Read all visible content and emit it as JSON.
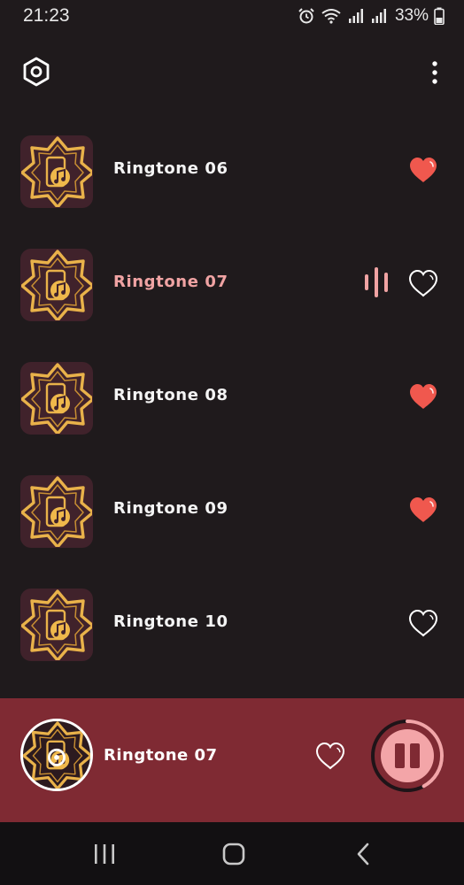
{
  "status_bar": {
    "time": "21:23",
    "battery": "33%"
  },
  "top_bar": {
    "settings_icon": "hexagon-settings-icon",
    "menu_icon": "more-vertical-icon"
  },
  "ringtones": [
    {
      "title": "Ringtone 06",
      "favorite": true,
      "playing": false
    },
    {
      "title": "Ringtone 07",
      "favorite": false,
      "playing": true
    },
    {
      "title": "Ringtone 08",
      "favorite": true,
      "playing": false
    },
    {
      "title": "Ringtone 09",
      "favorite": true,
      "playing": false
    },
    {
      "title": "Ringtone 10",
      "favorite": false,
      "playing": false
    }
  ],
  "player": {
    "title": "Ringtone 07",
    "favorite": false,
    "progress": 0.42,
    "state": "playing"
  },
  "colors": {
    "background": "#1f1a1c",
    "thumb_background": "#40222b",
    "gold": "#e9b24a",
    "playing_text": "#f0a3a3",
    "heart_filled": "#f0584e",
    "player_bar": "#7f2a33",
    "progress": "#f3a5a8"
  }
}
